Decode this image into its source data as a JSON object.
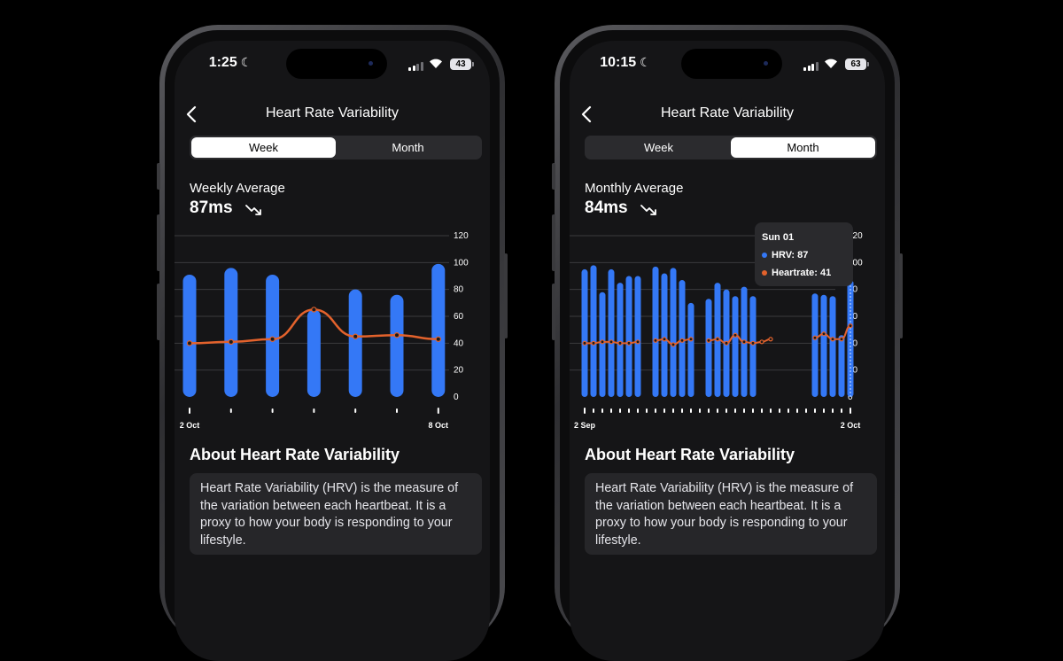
{
  "colors": {
    "hrv": "#3478f6",
    "heartrate": "#e3622c",
    "grid": "#3a3a3d",
    "axis_text": "#ffffff"
  },
  "phones": [
    {
      "status": {
        "time": "1:25",
        "battery": "43",
        "signal_bars": 2
      },
      "nav": {
        "title": "Heart Rate Variability",
        "back_icon": "chevron-left-icon"
      },
      "segment": {
        "options": [
          "Week",
          "Month"
        ],
        "selected": "Week"
      },
      "average": {
        "label": "Weekly Average",
        "value": "87ms",
        "trend_icon": "trend-down-icon"
      },
      "about": {
        "title": "About Heart Rate Variability",
        "text": "Heart Rate Variability (HRV) is the measure of the variation between each heartbeat. It is a proxy to how your body is responding to your lifestyle."
      }
    },
    {
      "status": {
        "time": "10:15",
        "battery": "63",
        "signal_bars": 3
      },
      "nav": {
        "title": "Heart Rate Variability",
        "back_icon": "chevron-left-icon"
      },
      "segment": {
        "options": [
          "Week",
          "Month"
        ],
        "selected": "Month"
      },
      "average": {
        "label": "Monthly Average",
        "value": "84ms",
        "trend_icon": "trend-down-icon"
      },
      "tooltip": {
        "title": "Sun 01",
        "hrv_text": "HRV: 87",
        "hr_text": "Heartrate: 41"
      },
      "about": {
        "title": "About Heart Rate Variability",
        "text": "Heart Rate Variability (HRV) is the measure of the variation between each heartbeat. It is a proxy to how your body is responding to your lifestyle."
      }
    }
  ],
  "chart_data": [
    {
      "type": "bar",
      "ylim": [
        0,
        120
      ],
      "yticks": [
        0,
        20,
        40,
        60,
        80,
        100,
        120
      ],
      "x_labels": [
        "2 Oct",
        "8 Oct"
      ],
      "categories": [
        "2 Oct",
        "3 Oct",
        "4 Oct",
        "5 Oct",
        "6 Oct",
        "7 Oct",
        "8 Oct"
      ],
      "series": [
        {
          "name": "HRV",
          "type": "bar",
          "values": [
            91,
            96,
            91,
            65,
            80,
            76,
            99
          ]
        },
        {
          "name": "Heartrate",
          "type": "line",
          "values": [
            40,
            41,
            43,
            65,
            45,
            46,
            43
          ]
        }
      ],
      "grid": true
    },
    {
      "type": "bar",
      "ylim": [
        0,
        120
      ],
      "yticks": [
        0,
        20,
        40,
        60,
        80,
        100,
        120
      ],
      "x_labels": [
        "2 Sep",
        "2 Oct"
      ],
      "categories": [
        "2 Sep",
        "3 Sep",
        "4 Sep",
        "5 Sep",
        "6 Sep",
        "7 Sep",
        "8 Sep",
        "9 Sep",
        "10 Sep",
        "11 Sep",
        "12 Sep",
        "13 Sep",
        "14 Sep",
        "15 Sep",
        "16 Sep",
        "17 Sep",
        "18 Sep",
        "19 Sep",
        "20 Sep",
        "21 Sep",
        "22 Sep",
        "23 Sep",
        "24 Sep",
        "25 Sep",
        "26 Sep",
        "27 Sep",
        "28 Sep",
        "29 Sep",
        "30 Sep",
        "1 Oct",
        "2 Oct"
      ],
      "series": [
        {
          "name": "HRV",
          "type": "bar",
          "values": [
            95,
            98,
            78,
            95,
            85,
            90,
            90,
            null,
            97,
            92,
            96,
            87,
            70,
            null,
            73,
            85,
            80,
            75,
            82,
            75,
            null,
            null,
            null,
            null,
            null,
            null,
            77,
            76,
            75,
            46,
            87
          ]
        },
        {
          "name": "Heartrate",
          "type": "line",
          "values": [
            40,
            40,
            41,
            41,
            40,
            40,
            41,
            null,
            42,
            43,
            39,
            42,
            43,
            null,
            42,
            43,
            40,
            46,
            41,
            40,
            41,
            43,
            null,
            null,
            null,
            null,
            44,
            47,
            43,
            43,
            53
          ]
        }
      ],
      "highlight_index": 30,
      "grid": true
    }
  ]
}
